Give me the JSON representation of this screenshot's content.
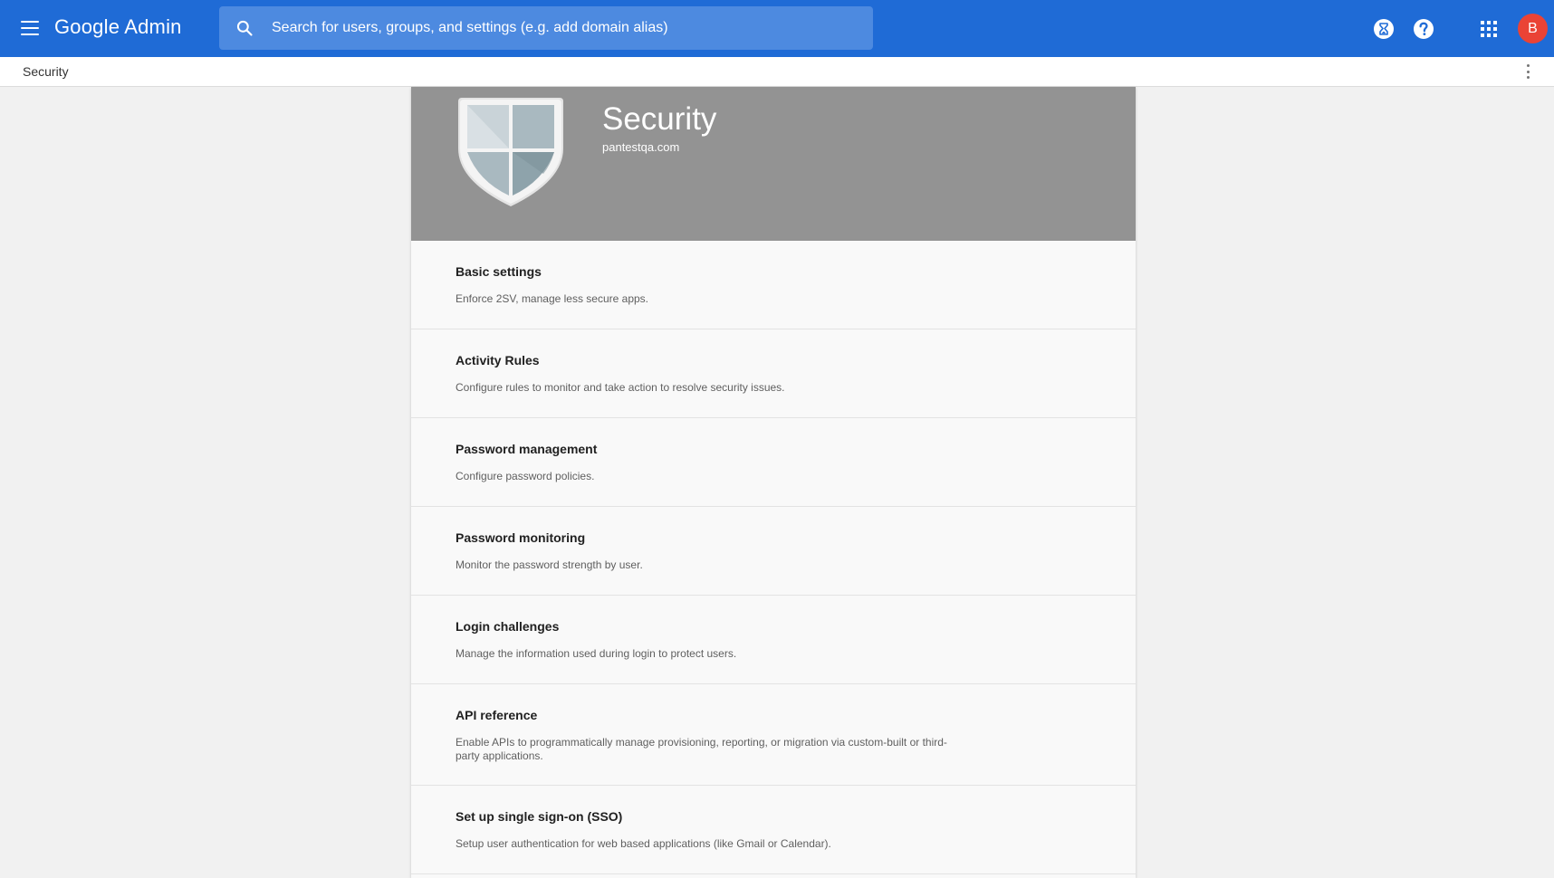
{
  "app": {
    "logo_text": "Google Admin"
  },
  "search": {
    "placeholder": "Search for users, groups, and settings (e.g. add domain alias)"
  },
  "header": {
    "avatar_initial": "B"
  },
  "breadcrumb": {
    "label": "Security"
  },
  "hero": {
    "title": "Security",
    "domain": "pantestqa.com"
  },
  "items": [
    {
      "title": "Basic settings",
      "description": "Enforce 2SV, manage less secure apps."
    },
    {
      "title": "Activity Rules",
      "description": "Configure rules to monitor and take action to resolve security issues."
    },
    {
      "title": "Password management",
      "description": "Configure password policies."
    },
    {
      "title": "Password monitoring",
      "description": "Monitor the password strength by user."
    },
    {
      "title": "Login challenges",
      "description": "Manage the information used during login to protect users."
    },
    {
      "title": "API reference",
      "description": "Enable APIs to programmatically manage provisioning, reporting, or migration via custom-built or third-party applications."
    },
    {
      "title": "Set up single sign-on (SSO)",
      "description": "Setup user authentication for web based applications (like Gmail or Calendar)."
    }
  ],
  "colors": {
    "topbar": "#1f6bd6",
    "search_bg": "#4d8ae0",
    "hero_bg": "#939393",
    "avatar": "#ea4335"
  },
  "icons": {
    "menu": "hamburger-menu-icon",
    "search": "search-icon",
    "hourglass": "hourglass-icon",
    "help": "help-icon",
    "apps": "apps-grid-icon",
    "more": "more-vertical-icon",
    "shield": "shield-icon"
  }
}
